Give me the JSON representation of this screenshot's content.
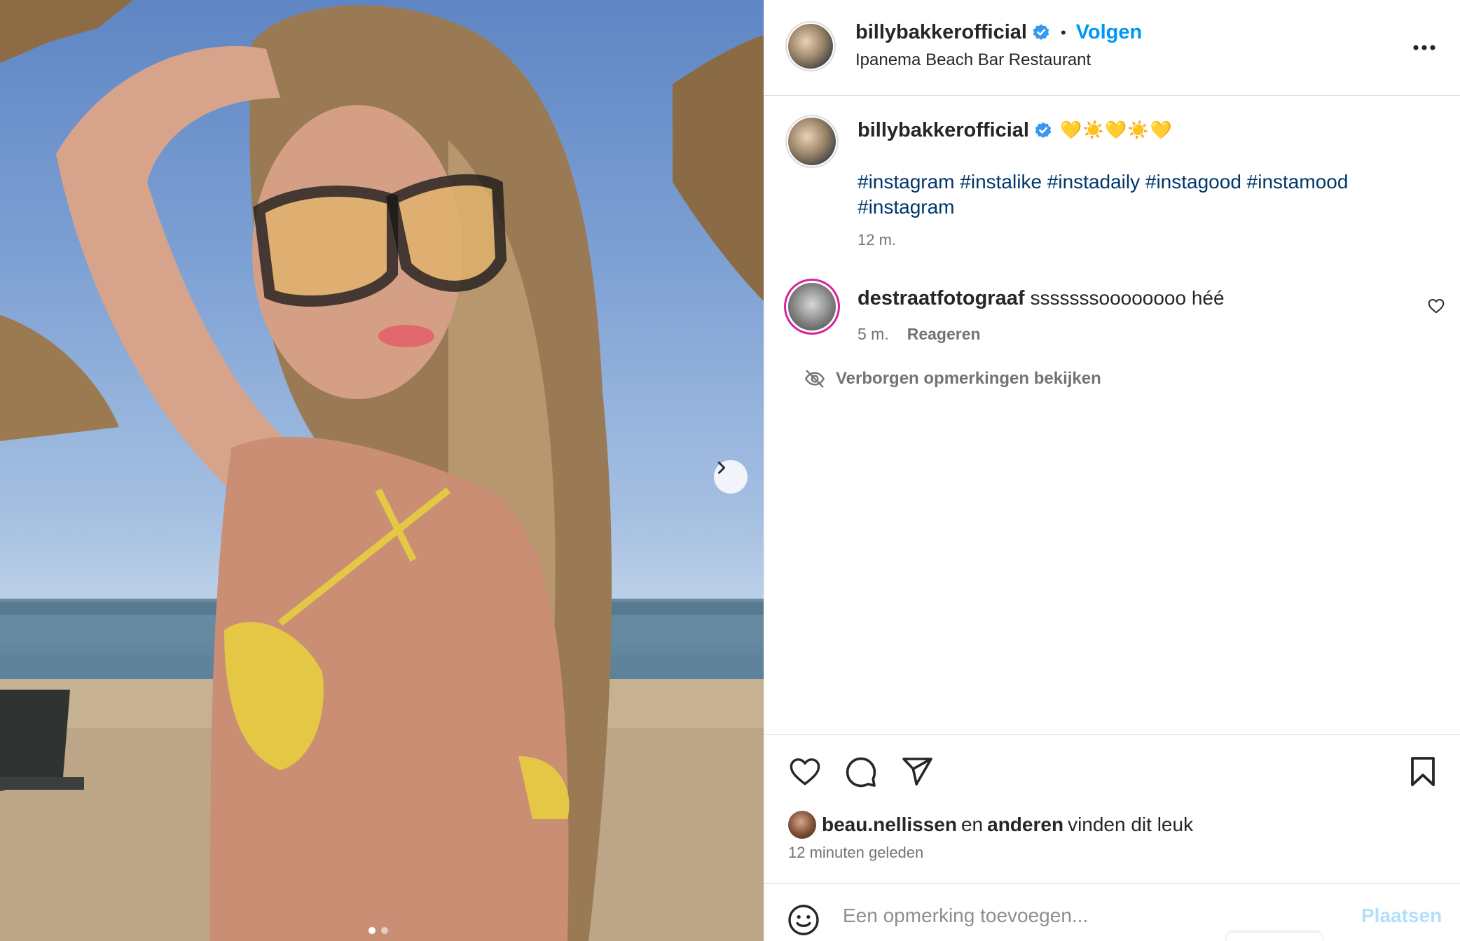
{
  "post": {
    "username": "billybakkerofficial",
    "follow_label": "Volgen",
    "separator": "•",
    "location": "Ipanema Beach Bar Restaurant",
    "caption_emoji": "💛☀️💛☀️💛",
    "hashtags": "#instagram #instalike #instadaily #instagood #instamood #instagram",
    "caption_time": "12 m."
  },
  "comment": {
    "username": "destraatfotograaf",
    "text": "sssssssoooooooo héé",
    "time": "5 m.",
    "reply_label": "Reageren"
  },
  "hidden_comments_label": "Verborgen opmerkingen bekijken",
  "likes": {
    "first_liker": "beau.nellissen",
    "connector": "en",
    "others": "anderen",
    "suffix": "vinden dit leuk",
    "time": "12 minuten geleden"
  },
  "composer": {
    "placeholder": "Een opmerking toevoegen...",
    "submit_label": "Plaatsen"
  },
  "colors": {
    "accent": "#0095f6",
    "hashtag": "#00376b",
    "verified": "#3897f0",
    "secondary_text": "#737373"
  },
  "icons": [
    "verified-badge-icon",
    "more-options-icon",
    "heart-icon",
    "comment-icon",
    "share-icon",
    "bookmark-icon",
    "emoji-icon",
    "hidden-eye-icon",
    "chevron-right-icon"
  ],
  "carousel": {
    "slides": 2,
    "active": 1
  }
}
